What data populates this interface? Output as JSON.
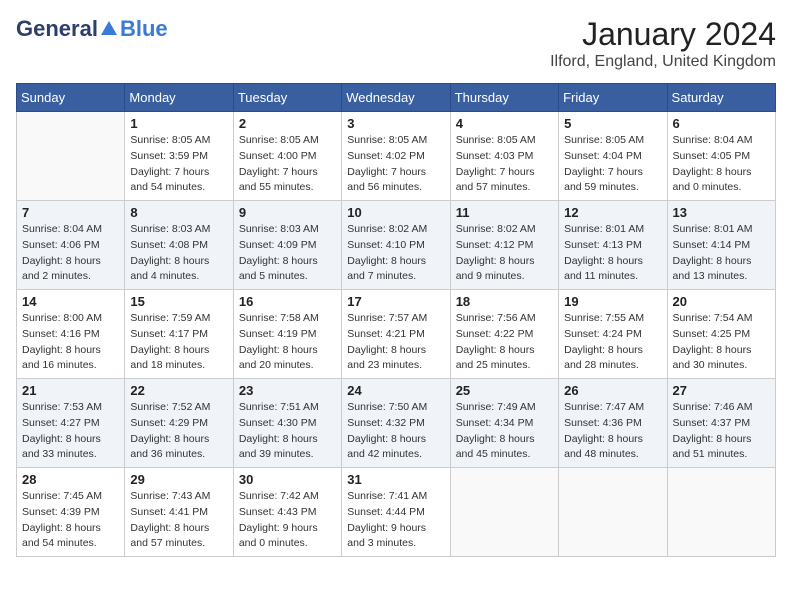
{
  "logo": {
    "general": "General",
    "blue": "Blue"
  },
  "title": "January 2024",
  "location": "Ilford, England, United Kingdom",
  "days_of_week": [
    "Sunday",
    "Monday",
    "Tuesday",
    "Wednesday",
    "Thursday",
    "Friday",
    "Saturday"
  ],
  "weeks": [
    [
      {
        "day": "",
        "info": ""
      },
      {
        "day": "1",
        "info": "Sunrise: 8:05 AM\nSunset: 3:59 PM\nDaylight: 7 hours\nand 54 minutes."
      },
      {
        "day": "2",
        "info": "Sunrise: 8:05 AM\nSunset: 4:00 PM\nDaylight: 7 hours\nand 55 minutes."
      },
      {
        "day": "3",
        "info": "Sunrise: 8:05 AM\nSunset: 4:02 PM\nDaylight: 7 hours\nand 56 minutes."
      },
      {
        "day": "4",
        "info": "Sunrise: 8:05 AM\nSunset: 4:03 PM\nDaylight: 7 hours\nand 57 minutes."
      },
      {
        "day": "5",
        "info": "Sunrise: 8:05 AM\nSunset: 4:04 PM\nDaylight: 7 hours\nand 59 minutes."
      },
      {
        "day": "6",
        "info": "Sunrise: 8:04 AM\nSunset: 4:05 PM\nDaylight: 8 hours\nand 0 minutes."
      }
    ],
    [
      {
        "day": "7",
        "info": "Sunrise: 8:04 AM\nSunset: 4:06 PM\nDaylight: 8 hours\nand 2 minutes."
      },
      {
        "day": "8",
        "info": "Sunrise: 8:03 AM\nSunset: 4:08 PM\nDaylight: 8 hours\nand 4 minutes."
      },
      {
        "day": "9",
        "info": "Sunrise: 8:03 AM\nSunset: 4:09 PM\nDaylight: 8 hours\nand 5 minutes."
      },
      {
        "day": "10",
        "info": "Sunrise: 8:02 AM\nSunset: 4:10 PM\nDaylight: 8 hours\nand 7 minutes."
      },
      {
        "day": "11",
        "info": "Sunrise: 8:02 AM\nSunset: 4:12 PM\nDaylight: 8 hours\nand 9 minutes."
      },
      {
        "day": "12",
        "info": "Sunrise: 8:01 AM\nSunset: 4:13 PM\nDaylight: 8 hours\nand 11 minutes."
      },
      {
        "day": "13",
        "info": "Sunrise: 8:01 AM\nSunset: 4:14 PM\nDaylight: 8 hours\nand 13 minutes."
      }
    ],
    [
      {
        "day": "14",
        "info": "Sunrise: 8:00 AM\nSunset: 4:16 PM\nDaylight: 8 hours\nand 16 minutes."
      },
      {
        "day": "15",
        "info": "Sunrise: 7:59 AM\nSunset: 4:17 PM\nDaylight: 8 hours\nand 18 minutes."
      },
      {
        "day": "16",
        "info": "Sunrise: 7:58 AM\nSunset: 4:19 PM\nDaylight: 8 hours\nand 20 minutes."
      },
      {
        "day": "17",
        "info": "Sunrise: 7:57 AM\nSunset: 4:21 PM\nDaylight: 8 hours\nand 23 minutes."
      },
      {
        "day": "18",
        "info": "Sunrise: 7:56 AM\nSunset: 4:22 PM\nDaylight: 8 hours\nand 25 minutes."
      },
      {
        "day": "19",
        "info": "Sunrise: 7:55 AM\nSunset: 4:24 PM\nDaylight: 8 hours\nand 28 minutes."
      },
      {
        "day": "20",
        "info": "Sunrise: 7:54 AM\nSunset: 4:25 PM\nDaylight: 8 hours\nand 30 minutes."
      }
    ],
    [
      {
        "day": "21",
        "info": "Sunrise: 7:53 AM\nSunset: 4:27 PM\nDaylight: 8 hours\nand 33 minutes."
      },
      {
        "day": "22",
        "info": "Sunrise: 7:52 AM\nSunset: 4:29 PM\nDaylight: 8 hours\nand 36 minutes."
      },
      {
        "day": "23",
        "info": "Sunrise: 7:51 AM\nSunset: 4:30 PM\nDaylight: 8 hours\nand 39 minutes."
      },
      {
        "day": "24",
        "info": "Sunrise: 7:50 AM\nSunset: 4:32 PM\nDaylight: 8 hours\nand 42 minutes."
      },
      {
        "day": "25",
        "info": "Sunrise: 7:49 AM\nSunset: 4:34 PM\nDaylight: 8 hours\nand 45 minutes."
      },
      {
        "day": "26",
        "info": "Sunrise: 7:47 AM\nSunset: 4:36 PM\nDaylight: 8 hours\nand 48 minutes."
      },
      {
        "day": "27",
        "info": "Sunrise: 7:46 AM\nSunset: 4:37 PM\nDaylight: 8 hours\nand 51 minutes."
      }
    ],
    [
      {
        "day": "28",
        "info": "Sunrise: 7:45 AM\nSunset: 4:39 PM\nDaylight: 8 hours\nand 54 minutes."
      },
      {
        "day": "29",
        "info": "Sunrise: 7:43 AM\nSunset: 4:41 PM\nDaylight: 8 hours\nand 57 minutes."
      },
      {
        "day": "30",
        "info": "Sunrise: 7:42 AM\nSunset: 4:43 PM\nDaylight: 9 hours\nand 0 minutes."
      },
      {
        "day": "31",
        "info": "Sunrise: 7:41 AM\nSunset: 4:44 PM\nDaylight: 9 hours\nand 3 minutes."
      },
      {
        "day": "",
        "info": ""
      },
      {
        "day": "",
        "info": ""
      },
      {
        "day": "",
        "info": ""
      }
    ]
  ]
}
